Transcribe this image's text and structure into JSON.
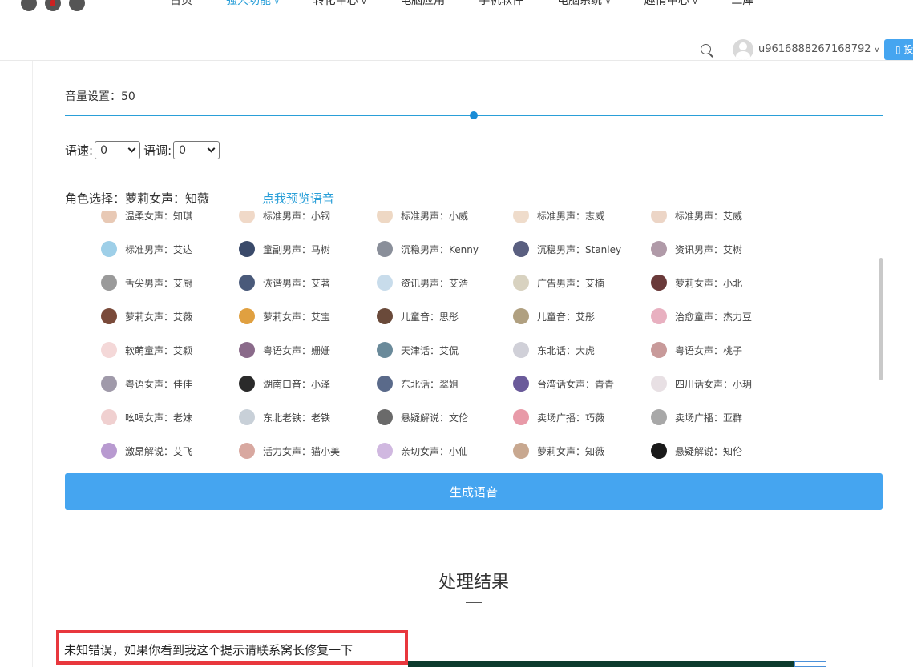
{
  "nav": {
    "items": [
      {
        "label": "首页",
        "active": false,
        "dropdown": false
      },
      {
        "label": "强大功能",
        "active": true,
        "dropdown": true
      },
      {
        "label": "转化中心",
        "active": false,
        "dropdown": true
      },
      {
        "label": "电脑应用",
        "active": false,
        "dropdown": false
      },
      {
        "label": "手机软件",
        "active": false,
        "dropdown": false
      },
      {
        "label": "电脑系统",
        "active": false,
        "dropdown": true
      },
      {
        "label": "趣情中心",
        "active": false,
        "dropdown": true
      },
      {
        "label": "二库",
        "active": false,
        "dropdown": false
      }
    ]
  },
  "user": {
    "name": "u9616888267168792",
    "button_label": "投"
  },
  "volume": {
    "label": "音量设置：",
    "value": "50",
    "fraction": 0.5
  },
  "speed": {
    "label": "语速:",
    "value": "0"
  },
  "tone": {
    "label": "语调:",
    "value": "0"
  },
  "role": {
    "label": "角色选择：萝莉女声：知薇",
    "preview_link": "点我预览语音"
  },
  "voices": [
    [
      "温柔女声：知琪",
      "标准男声：小钢",
      "标准男声：小威",
      "标准男声：志威",
      "标准男声：艾威"
    ],
    [
      "标准男声：艾达",
      "童副男声：马树",
      "沉稳男声：Kenny",
      "沉稳男声：Stanley",
      "资讯男声：艾树"
    ],
    [
      "舌尖男声：艾厨",
      "诙谐男声：艾著",
      "资讯男声：艾浩",
      "广告男声：艾楠",
      "萝莉女声：小北"
    ],
    [
      "萝莉女声：艾薇",
      "萝莉女声：艾宝",
      "儿童音：思彤",
      "儿童音：艾彤",
      "治愈童声：杰力豆"
    ],
    [
      "软萌童声：艾颖",
      "粤语女声：姗姗",
      "天津话：艾侃",
      "东北话：大虎",
      "粤语女声：桃子"
    ],
    [
      "粤语女声：佳佳",
      "湖南口音：小泽",
      "东北话：翠姐",
      "台湾话女声：青青",
      "四川话女声：小玥"
    ],
    [
      "吆喝女声：老妹",
      "东北老铁：老铁",
      "悬疑解说：文伦",
      "卖场广播：巧薇",
      "卖场广播：亚群"
    ],
    [
      "激昂解说：艾飞",
      "活力女声：猫小美",
      "亲切女声：小仙",
      "萝莉女声：知薇",
      "悬疑解说：知伦"
    ]
  ],
  "avatar_colors": [
    [
      "#e8c9b5",
      "#f0d9c8",
      "#eed8c4",
      "#efdccb",
      "#ecd5c6"
    ],
    [
      "#9ecfe8",
      "#3a4a6a",
      "#8a8f9a",
      "#5a5f80",
      "#b09aa8"
    ],
    [
      "#9a9a9a",
      "#4a5a7a",
      "#c8dceb",
      "#d8d2c0",
      "#6a3a3a"
    ],
    [
      "#7a4a3a",
      "#e0a040",
      "#6a4a3a",
      "#b0a080",
      "#e8b0c0"
    ],
    [
      "#f4d8d8",
      "#8a6a8a",
      "#6a8a9a",
      "#d0d0d8",
      "#c89a9a"
    ],
    [
      "#a09aaa",
      "#2a2a2a",
      "#5a6a8a",
      "#6a5a9a",
      "#e8e0e4"
    ],
    [
      "#f0d0d0",
      "#c8d0d8",
      "#6a6a6a",
      "#e89aa8",
      "#a8a8a8"
    ],
    [
      "#b89ad0",
      "#d8a8a0",
      "#d0b8e0",
      "#c8a890",
      "#1a1a1a"
    ]
  ],
  "generate_button": "生成语音",
  "result": {
    "title": "处理结果",
    "error_message": "未知错误，如果你看到我这个提示请联系窝长修复一下"
  },
  "colors": {
    "accent": "#2a9fd8",
    "button": "#45a5f0",
    "error_border": "#e8373d"
  }
}
